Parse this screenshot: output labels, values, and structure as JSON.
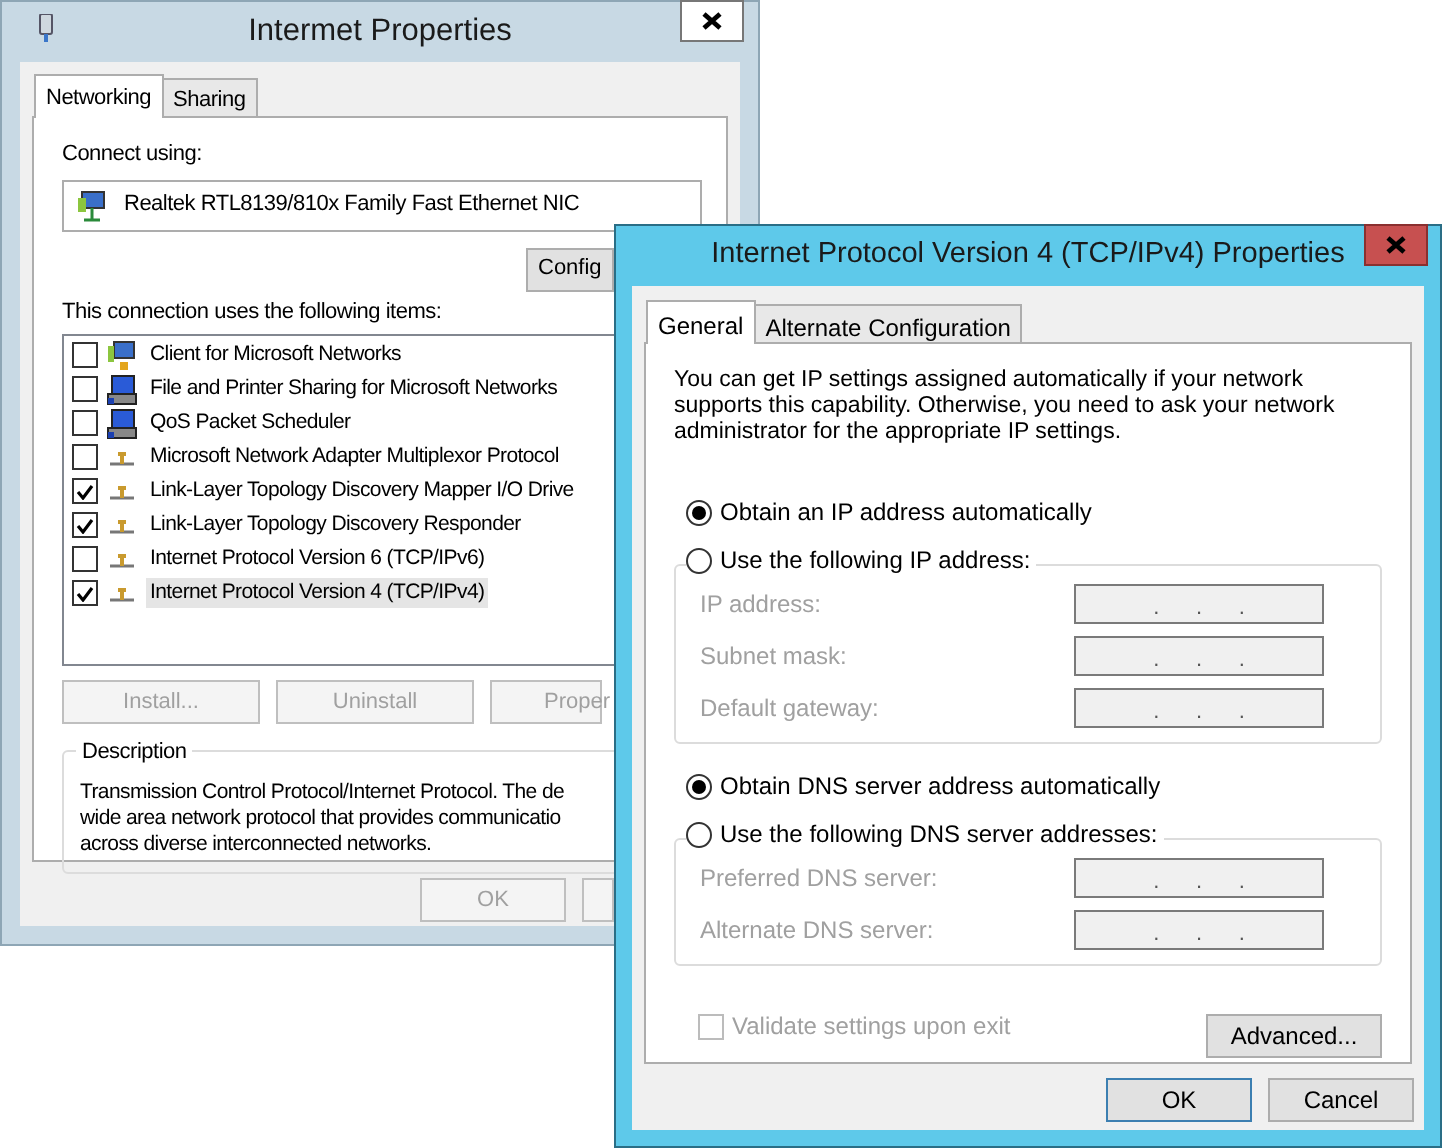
{
  "back_window": {
    "title": "Intermet Properties",
    "tabs": [
      {
        "label": "Networking",
        "selected": true
      },
      {
        "label": "Sharing",
        "selected": false
      }
    ],
    "connect_using_label": "Connect using:",
    "adapter": "Realtek RTL8139/810x Family Fast Ethernet NIC",
    "configure_button": "Config",
    "items_label": "This connection uses the following items:",
    "items": [
      {
        "kind": "client",
        "label": "Client for Microsoft Networks",
        "checked": false,
        "selected": false
      },
      {
        "kind": "service",
        "label": "File and Printer Sharing for Microsoft Networks",
        "checked": false,
        "selected": false
      },
      {
        "kind": "service",
        "label": "QoS Packet Scheduler",
        "checked": false,
        "selected": false
      },
      {
        "kind": "protocol",
        "label": "Microsoft Network Adapter Multiplexor Protocol",
        "checked": false,
        "selected": false
      },
      {
        "kind": "protocol",
        "label": "Link-Layer Topology Discovery Mapper I/O Drive",
        "checked": true,
        "selected": false
      },
      {
        "kind": "protocol",
        "label": "Link-Layer Topology Discovery Responder",
        "checked": true,
        "selected": false
      },
      {
        "kind": "protocol",
        "label": "Internet Protocol Version 6 (TCP/IPv6)",
        "checked": false,
        "selected": false
      },
      {
        "kind": "protocol",
        "label": "Internet Protocol Version 4 (TCP/IPv4)",
        "checked": true,
        "selected": true
      }
    ],
    "item_buttons": [
      {
        "label": "Install...",
        "disabled": true
      },
      {
        "label": "Uninstall",
        "disabled": true
      },
      {
        "label": "Proper",
        "disabled": true
      }
    ],
    "description": {
      "legend": "Description",
      "lines": [
        "Transmission Control Protocol/Internet Protocol. The de",
        "wide area network protocol that provides communicatio",
        "across diverse interconnected networks."
      ]
    },
    "dialog_buttons": [
      {
        "label": "OK",
        "disabled": true
      }
    ]
  },
  "front_window": {
    "title": "Internet Protocol Version 4 (TCP/IPv4) Properties",
    "tabs": [
      {
        "label": "General",
        "selected": true
      },
      {
        "label": "Alternate Configuration",
        "selected": false
      }
    ],
    "intro": "You can get IP settings assigned automatically if your network supports this capability. Otherwise, you need to ask your network administrator for the appropriate IP settings.",
    "ip_options": [
      {
        "label": "Obtain an IP address automatically",
        "selected": true
      },
      {
        "label": "Use the following IP address:",
        "selected": false
      }
    ],
    "ip_fields": [
      {
        "label": "IP address:",
        "value": ".      .      .",
        "disabled": true
      },
      {
        "label": "Subnet mask:",
        "value": ".      .      .",
        "disabled": true
      },
      {
        "label": "Default gateway:",
        "value": ".      .      .",
        "disabled": true
      }
    ],
    "dns_options": [
      {
        "label": "Obtain DNS server address automatically",
        "selected": true
      },
      {
        "label": "Use the following DNS server addresses:",
        "selected": false
      }
    ],
    "dns_fields": [
      {
        "label": "Preferred DNS server:",
        "value": ".      .      .",
        "disabled": true
      },
      {
        "label": "Alternate DNS server:",
        "value": ".      .      .",
        "disabled": true
      }
    ],
    "validate": {
      "label": "Validate settings upon exit",
      "checked": false,
      "disabled": true
    },
    "advanced_button": "Advanced...",
    "dialog_buttons": [
      {
        "label": "OK",
        "default": true
      },
      {
        "label": "Cancel",
        "default": false
      }
    ]
  }
}
